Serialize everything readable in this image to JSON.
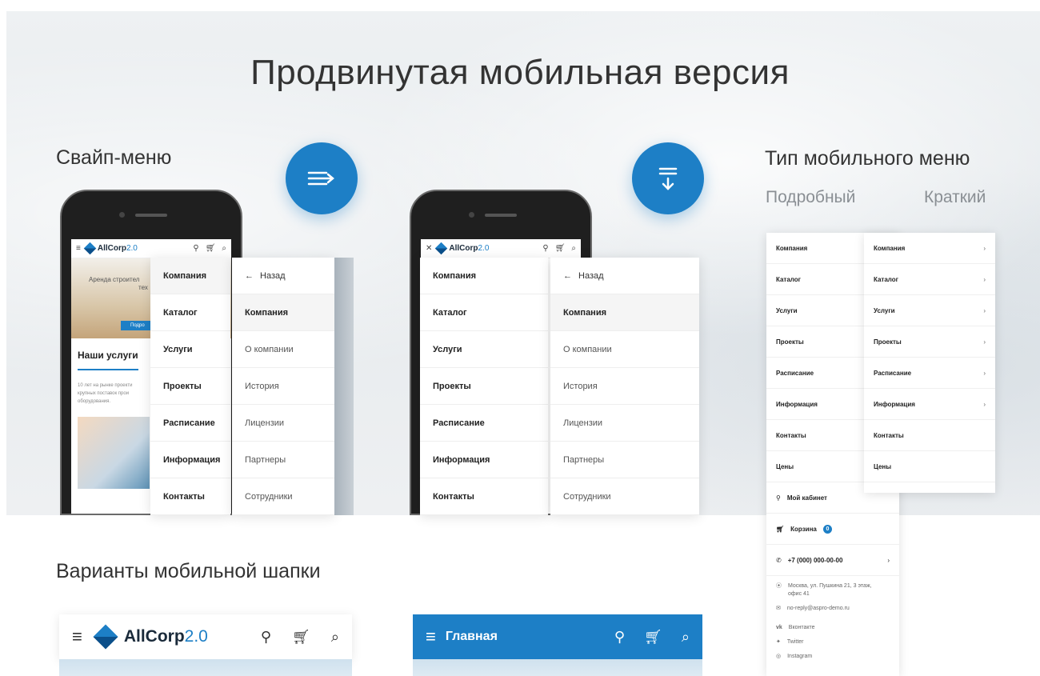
{
  "title": "Продвинутая мобильная версия",
  "sections": {
    "swipe": "Свайп-меню",
    "menu_type": "Тип мобильного меню",
    "menu_type_options": [
      "Подробный",
      "Краткий"
    ],
    "headers": "Варианты мобильной шапки"
  },
  "brand": {
    "name": "AllCorp",
    "version": "2.0"
  },
  "header_main_label": "Главная",
  "cart_count": "0",
  "menu": {
    "primary": [
      "Компания",
      "Каталог",
      "Услуги",
      "Проекты",
      "Расписание",
      "Информация",
      "Контакты"
    ],
    "back": "Назад",
    "sub_title": "Компания",
    "sub": [
      "О компании",
      "История",
      "Лицензии",
      "Партнеры",
      "Сотрудники"
    ]
  },
  "page_preview": {
    "banner": "Аренда строител",
    "banner2": "тех",
    "services": "Наши услуги",
    "desc": "10 лет на рынке проекти крупных поставок прои оборудования.",
    "button": "Подро"
  },
  "right_menu": {
    "items": [
      "Компания",
      "Каталог",
      "Услуги",
      "Проекты",
      "Расписание",
      "Информация",
      "Контакты",
      "Цены"
    ],
    "has_arrow": [
      true,
      true,
      true,
      true,
      true,
      true,
      false,
      false
    ],
    "cabinet": "Мой кабинет",
    "cart": "Корзина",
    "phone": "+7 (000) 000-00-00",
    "address": "Москва, ул. Пушкина 21, 3 этаж, офис 41",
    "email": "no-reply@aspro-demo.ru",
    "socials": [
      "Вконтакте",
      "Twitter",
      "Instagram"
    ]
  },
  "colors": {
    "accent": "#1d7fc6",
    "text": "#333333",
    "muted": "#8a8f94"
  }
}
